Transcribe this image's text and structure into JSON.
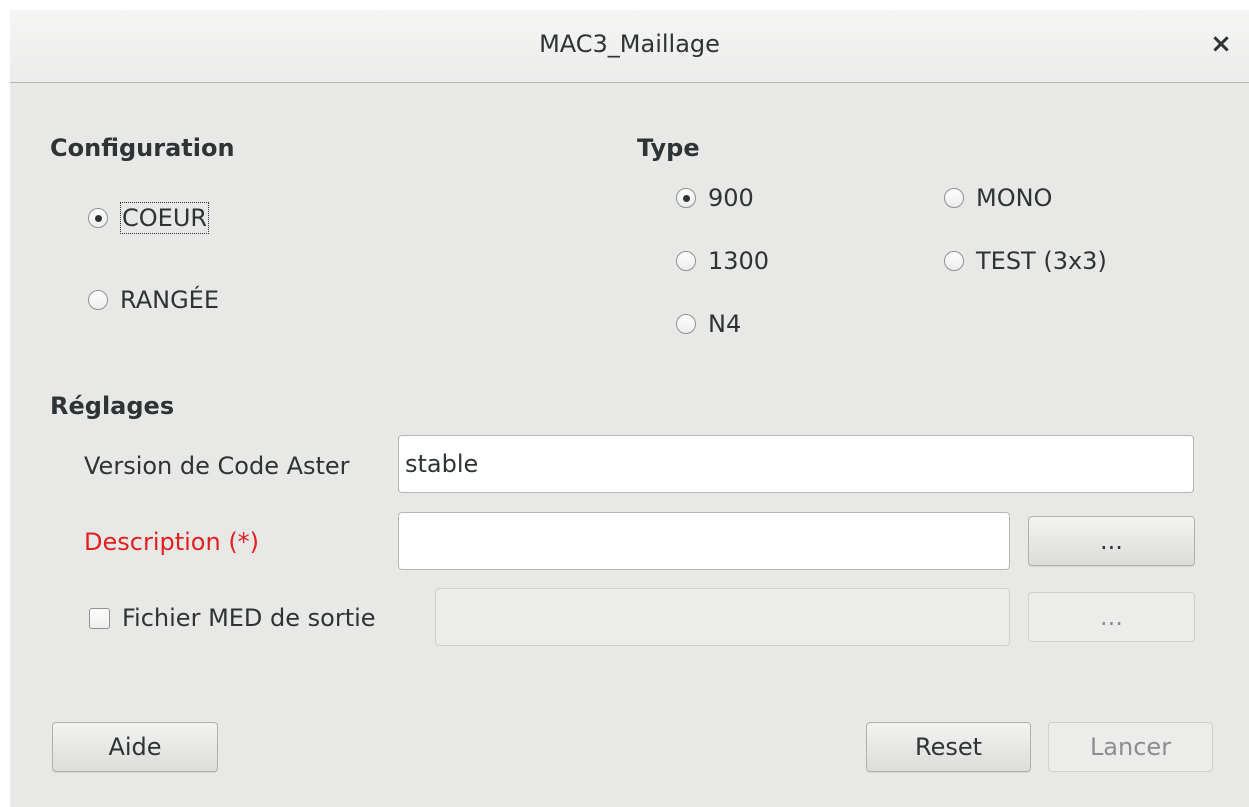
{
  "window": {
    "title": "MAC3_Maillage",
    "close_glyph": "×"
  },
  "configuration": {
    "label": "Configuration",
    "options": [
      {
        "label": "COEUR",
        "checked": true
      },
      {
        "label": "RANGÉE",
        "checked": false
      }
    ]
  },
  "type": {
    "label": "Type",
    "options": [
      {
        "label": "900",
        "checked": true
      },
      {
        "label": "MONO",
        "checked": false
      },
      {
        "label": "1300",
        "checked": false
      },
      {
        "label": "TEST (3x3)",
        "checked": false
      },
      {
        "label": "N4",
        "checked": false
      }
    ]
  },
  "reglages": {
    "label": "Réglages",
    "version": {
      "label": "Version de Code Aster",
      "value": "stable"
    },
    "description": {
      "label": "Description (*)",
      "value": "",
      "browse_label": "...",
      "required_color": "#e51e1e"
    },
    "med_output": {
      "label": "Fichier MED de sortie",
      "checked": false,
      "value": "",
      "browse_label": "..."
    }
  },
  "footer": {
    "help_label": "Aide",
    "reset_label": "Reset",
    "run_label": "Lancer"
  }
}
